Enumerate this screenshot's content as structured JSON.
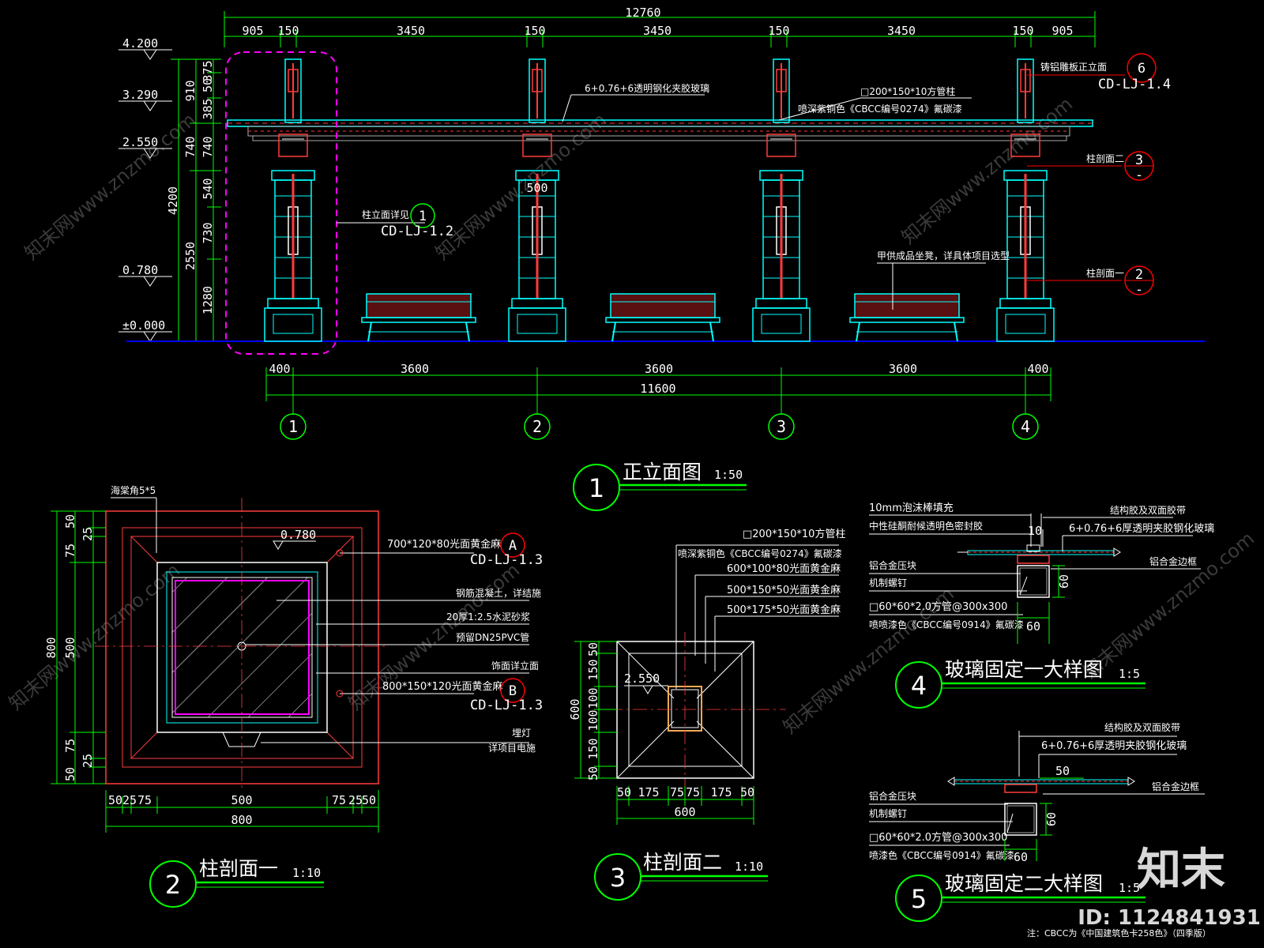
{
  "colors": {
    "background": "#000000",
    "dimension": "#00ff00",
    "structure": "#00ffff",
    "rebar": "#ff0000",
    "highlight": "#ff00ff",
    "ground": "#0000ff",
    "text": "#ffffff",
    "column_fill": "#ff3c3c"
  },
  "elevation": {
    "top_dims": [
      "905",
      "150",
      "3450",
      "150",
      "3450",
      "150",
      "3450",
      "150",
      "905"
    ],
    "total_top": "12760",
    "level_marks": [
      "4.200",
      "3.290",
      "2.550",
      "0.780",
      "±0.000"
    ],
    "left_dims_outer": [
      "4200"
    ],
    "left_dims_mid": [
      "910",
      "740",
      "2550"
    ],
    "left_dims_inner": [
      "375",
      "50",
      "385",
      "740",
      "540",
      "730",
      "1280"
    ],
    "bottom_dims": [
      "400",
      "3600",
      "3600",
      "3600",
      "400"
    ],
    "total_bottom": "11600",
    "axes": [
      "1",
      "2",
      "3",
      "4"
    ],
    "column_width_label": "500",
    "callouts": {
      "glass": "6+0.76+6透明钢化夹胶玻璃",
      "tube": "□200*150*10方管柱",
      "tube_paint": "喷深紫铜色《CBCC编号0274》氟碳漆",
      "cast_panel": "铸铝雕板正立面",
      "cast_ref_num": "6",
      "cast_ref_code": "CD-LJ-1.4",
      "section2": "柱剖面二",
      "section2_num": "3",
      "section1": "柱剖面一",
      "section1_num": "2",
      "dash": "-",
      "bench": "甲供成品坐凳，详具体项目选型",
      "col_detail": "柱立面详见",
      "col_detail_num": "1",
      "col_detail_code": "CD-LJ-1.2"
    },
    "title_num": "1",
    "title": "正立面图",
    "scale": "1:50"
  },
  "section1": {
    "labels": [
      "海棠角5*5",
      "700*120*80光面黄金麻",
      "钢筋混凝土，详结施",
      "20厚1:2.5水泥砂浆",
      "预留DN25PVC管",
      "饰面详立面",
      "800*150*120光面黄金麻",
      "埋灯",
      "详项目电施"
    ],
    "ref_a": "A",
    "ref_a_code": "CD-LJ-1.3",
    "ref_b": "B",
    "ref_b_code": "CD-LJ-1.3",
    "level": "0.780",
    "left_dims": [
      "50",
      "25",
      "75",
      "500",
      "75",
      "25",
      "50"
    ],
    "left_total": "800",
    "left_total_inner": "500",
    "bottom_dims": [
      "50",
      "25",
      "75",
      "500",
      "75",
      "25",
      "50"
    ],
    "bottom_total": "800",
    "title_num": "2",
    "title": "柱剖面一",
    "scale": "1:10"
  },
  "section2": {
    "labels": [
      "□200*150*10方管柱",
      "喷深紫铜色《CBCC编号0274》氟碳漆",
      "600*100*80光面黄金麻",
      "500*150*50光面黄金麻",
      "500*175*50光面黄金麻"
    ],
    "level": "2.550",
    "left_dims": [
      "50",
      "150",
      "100",
      "100",
      "150",
      "50"
    ],
    "left_total": "600",
    "bottom_dims": [
      "50",
      "175",
      "75",
      "75",
      "175",
      "50"
    ],
    "bottom_total": "600",
    "title_num": "3",
    "title": "柱剖面二",
    "scale": "1:10"
  },
  "detail4": {
    "labels_left": [
      "10mm泡沫棒填充",
      "中性硅酮耐候透明色密封胶",
      "铝合金压块",
      "机制螺钉",
      "□60*60*2.0方管@300x300",
      "喷喷漆色《CBCC编号0914》氟碳漆"
    ],
    "labels_right": [
      "结构胶及双面胶带",
      "6+0.76+6厚透明夹胶钢化玻璃",
      "铝合金边框"
    ],
    "dims": [
      "10",
      "60",
      "60"
    ],
    "title_num": "4",
    "title": "玻璃固定一大样图",
    "scale": "1:5"
  },
  "detail5": {
    "labels_left": [
      "铝合金压块",
      "机制螺钉",
      "□60*60*2.0方管@300x300",
      "喷漆色《CBCC编号0914》氟碳漆"
    ],
    "labels_right": [
      "结构胶及双面胶带",
      "6+0.76+6厚透明夹胶钢化玻璃",
      "铝合金边框"
    ],
    "dims": [
      "50",
      "60",
      "60"
    ],
    "title_num": "5",
    "title": "玻璃固定二大样图",
    "scale": "1:5"
  },
  "footer_note": "注：CBCC为《中国建筑色卡258色》（四季版）",
  "brand": {
    "logo": "知末",
    "id": "ID: 1124841931",
    "watermark": "知末网www.znzmo.com"
  }
}
